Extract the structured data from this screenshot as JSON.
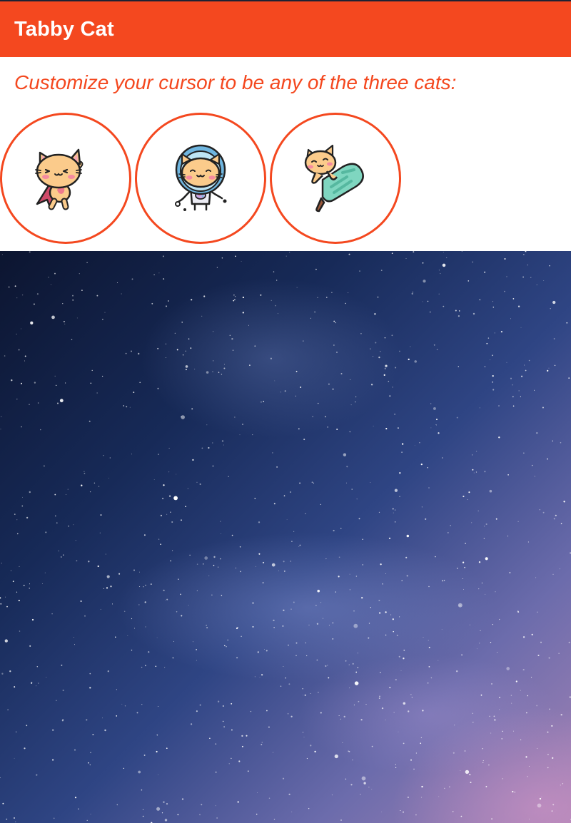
{
  "app": {
    "title": "Tabby Cat",
    "accent_color": "#f4481f"
  },
  "instructions": "Customize your cursor to be any of the three cats:",
  "cats": [
    {
      "name": "superhero-cat",
      "icon": "flying-superhero-cat-icon"
    },
    {
      "name": "astronaut-cat",
      "icon": "astronaut-cat-icon"
    },
    {
      "name": "popsicle-cat",
      "icon": "popsicle-cat-icon"
    }
  ],
  "background": {
    "icon": "starry-night-sky",
    "colors": [
      "#0c1530",
      "#2f4584",
      "#a583b4"
    ]
  }
}
